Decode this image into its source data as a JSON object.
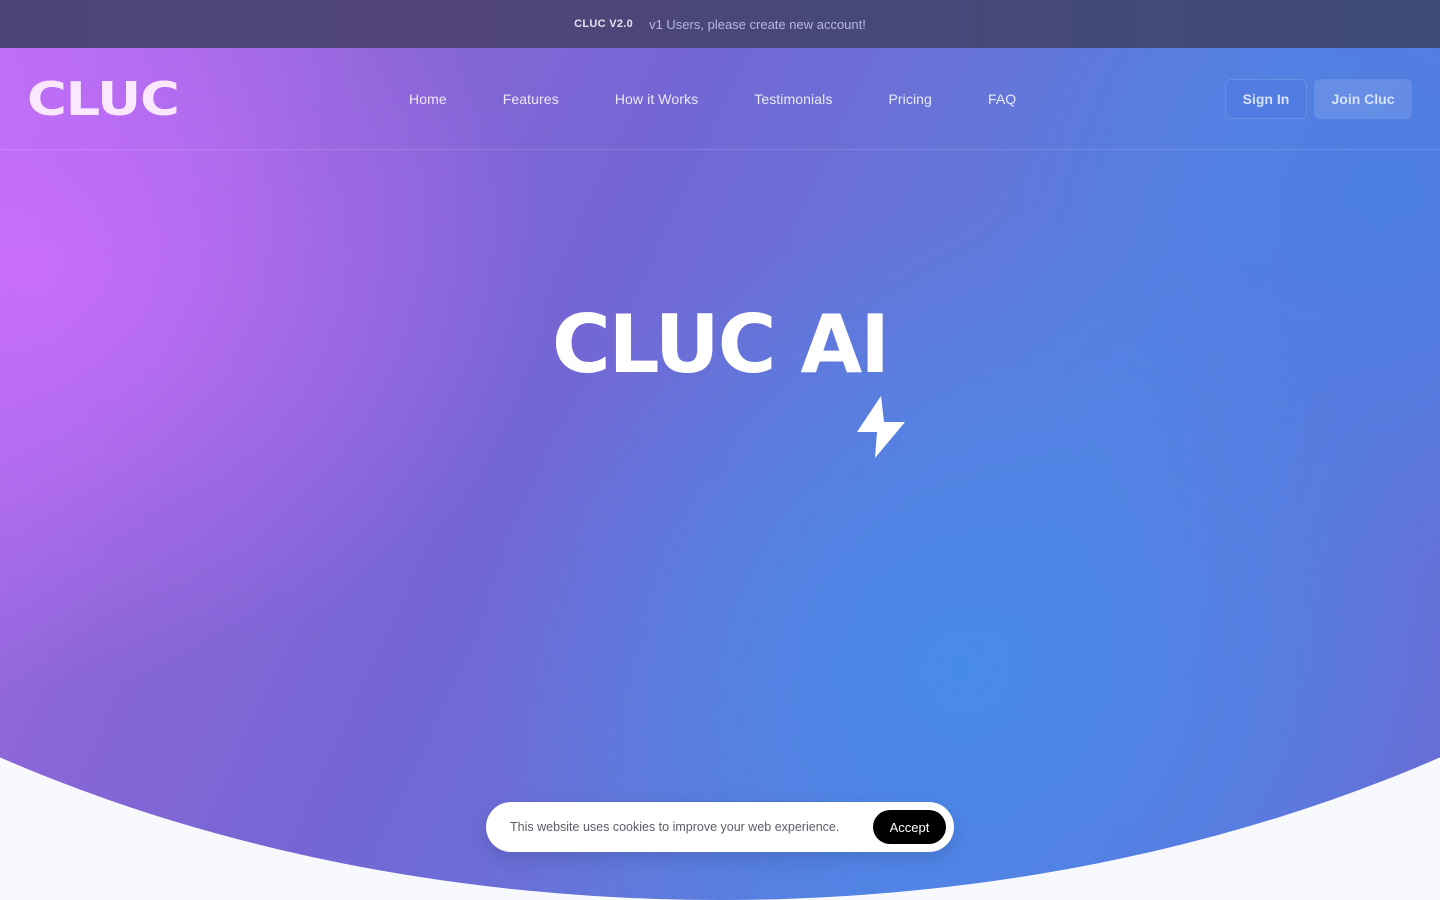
{
  "announcement": {
    "version": "CLUC V2.0",
    "message": "v1 Users, please create new account!"
  },
  "header": {
    "logo": "CLUC",
    "nav": [
      {
        "label": "Home"
      },
      {
        "label": "Features"
      },
      {
        "label": "How it Works"
      },
      {
        "label": "Testimonials"
      },
      {
        "label": "Pricing"
      },
      {
        "label": "FAQ"
      }
    ],
    "sign_in_label": "Sign In",
    "join_label": "Join Cluc"
  },
  "hero": {
    "title": "CLUC AI",
    "icon": "lightning-bolt-icon"
  },
  "cookie_banner": {
    "text": "This website uses cookies to improve your web experience.",
    "accept_label": "Accept"
  },
  "colors": {
    "accent_purple": "#c876ff",
    "accent_blue": "#4a86e8",
    "announce_bg": "#474878"
  }
}
